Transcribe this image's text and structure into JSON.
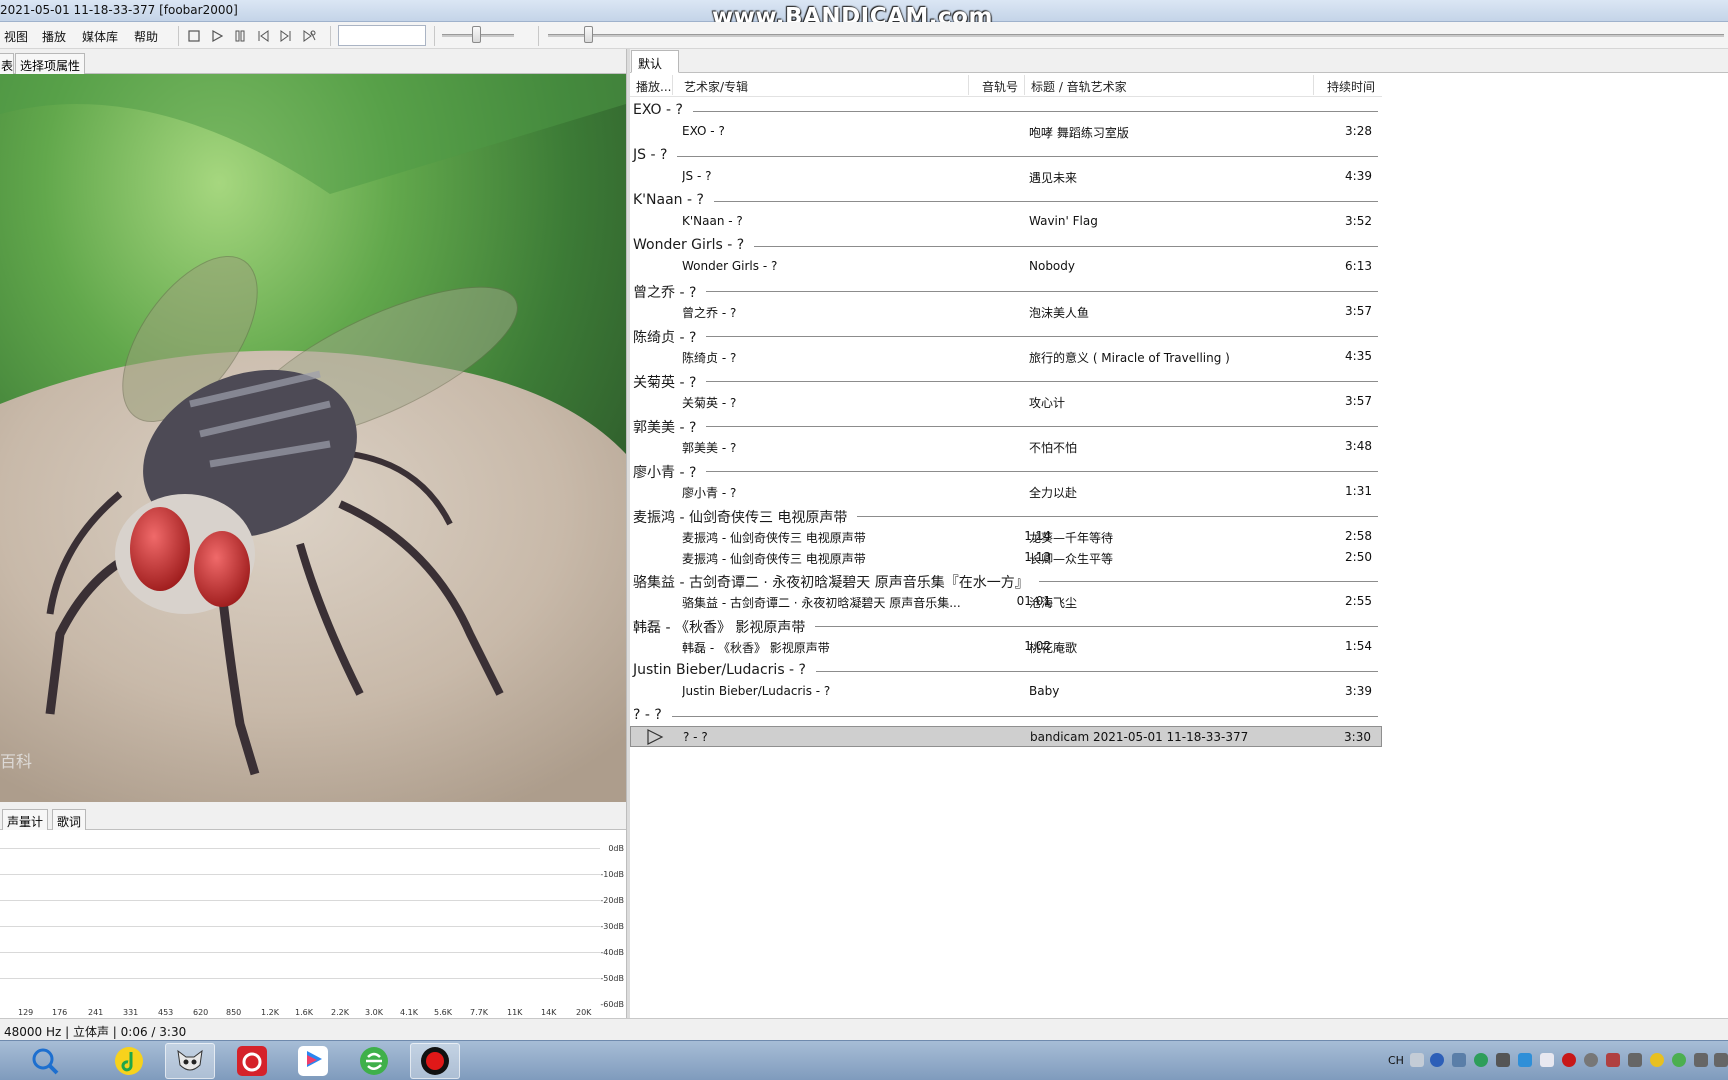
{
  "window": {
    "title": "2021-05-01 11-18-33-377  [foobar2000]",
    "watermark": "www.BANDICAM.com"
  },
  "menu": [
    "视图",
    "播放",
    "媒体库",
    "帮助"
  ],
  "toolbar": {
    "buttons": [
      "stop-icon",
      "play-icon",
      "pause-icon",
      "previous-icon",
      "next-icon",
      "random-icon"
    ]
  },
  "left_panel": {
    "tabs": [
      "表",
      "选择项属性"
    ],
    "artwork_watermark": "百科",
    "bottom_tabs": [
      "声量计",
      "歌词"
    ],
    "spectrum": {
      "db_labels": [
        "0dB",
        "-10dB",
        "-20dB",
        "-30dB",
        "-40dB",
        "-50dB",
        "-60dB"
      ],
      "freq_labels": [
        "129",
        "176",
        "241",
        "331",
        "453",
        "620",
        "850",
        "1.2K",
        "1.6K",
        "2.2K",
        "3.0K",
        "4.1K",
        "5.6K",
        "7.7K",
        "11K",
        "14K",
        "20K"
      ]
    }
  },
  "playlist": {
    "tab": "默认",
    "columns": {
      "playing": "播放...",
      "artist_album": "艺术家/专辑",
      "track_no": "音轨号",
      "title_artist": "标题 / 音轨艺术家",
      "duration": "持续时间"
    },
    "groups": [
      {
        "name": "EXO - ?",
        "tracks": [
          {
            "artist": "EXO - ?",
            "track": "",
            "title": "咆哮 舞蹈练习室版",
            "duration": "3:28"
          }
        ]
      },
      {
        "name": "JS - ?",
        "tracks": [
          {
            "artist": "JS - ?",
            "track": "",
            "title": "遇见未来",
            "duration": "4:39"
          }
        ]
      },
      {
        "name": "K'Naan - ?",
        "tracks": [
          {
            "artist": "K'Naan - ?",
            "track": "",
            "title": "Wavin' Flag",
            "duration": "3:52"
          }
        ]
      },
      {
        "name": "Wonder Girls - ?",
        "tracks": [
          {
            "artist": "Wonder Girls - ?",
            "track": "",
            "title": "Nobody",
            "duration": "6:13"
          }
        ]
      },
      {
        "name": "曾之乔 - ?",
        "tracks": [
          {
            "artist": "曾之乔 - ?",
            "track": "",
            "title": "泡沫美人鱼",
            "duration": "3:57"
          }
        ]
      },
      {
        "name": "陈绮贞 - ?",
        "tracks": [
          {
            "artist": "陈绮贞 - ?",
            "track": "",
            "title": "旅行的意义 ( Miracle of Travelling )",
            "duration": "4:35"
          }
        ]
      },
      {
        "name": "关菊英 - ?",
        "tracks": [
          {
            "artist": "关菊英 - ?",
            "track": "",
            "title": "攻心计",
            "duration": "3:57"
          }
        ]
      },
      {
        "name": "郭美美 - ?",
        "tracks": [
          {
            "artist": "郭美美 - ?",
            "track": "",
            "title": "不怕不怕",
            "duration": "3:48"
          }
        ]
      },
      {
        "name": "廖小青 - ?",
        "tracks": [
          {
            "artist": "廖小青 - ?",
            "track": "",
            "title": "全力以赴",
            "duration": "1:31"
          }
        ]
      },
      {
        "name": "麦振鸿 - 仙剑奇侠传三 电视原声带",
        "tracks": [
          {
            "artist": "麦振鸿 - 仙剑奇侠传三 电视原声带",
            "track": "1.14",
            "title": "龙葵—千年等待",
            "duration": "2:58"
          },
          {
            "artist": "麦振鸿 - 仙剑奇侠传三 电视原声带",
            "track": "1.13",
            "title": "长卿—众生平等",
            "duration": "2:50"
          }
        ]
      },
      {
        "name": "骆集益 - 古剑奇谭二 · 永夜初晗凝碧天 原声音乐集『在水一方』",
        "tracks": [
          {
            "artist": "骆集益 - 古剑奇谭二 · 永夜初晗凝碧天 原声音乐集...",
            "track": "01.01",
            "title": "沧海飞尘",
            "duration": "2:55"
          }
        ]
      },
      {
        "name": "韩磊 - 《秋香》 影视原声带",
        "tracks": [
          {
            "artist": "韩磊 - 《秋香》 影视原声带",
            "track": "1.02",
            "title": "桃花庵歌",
            "duration": "1:54"
          }
        ]
      },
      {
        "name": "Justin Bieber/Ludacris - ?",
        "tracks": [
          {
            "artist": "Justin Bieber/Ludacris - ?",
            "track": "",
            "title": "Baby",
            "duration": "3:39"
          }
        ]
      },
      {
        "name": "? - ?",
        "tracks": [
          {
            "artist": "? - ?",
            "track": "",
            "title": "bandicam 2021-05-01 11-18-33-377",
            "duration": "3:30",
            "playing": true
          }
        ]
      }
    ]
  },
  "status": {
    "text": "48000 Hz | 立体声 | 0:06 / 3:30"
  },
  "taskbar": {
    "apps": [
      "search-app-icon",
      "qq-music-icon",
      "foobar2000-icon",
      "netease-music-icon",
      "youku-icon",
      "browser-icon",
      "bandicam-icon"
    ],
    "tray_lang": "CH"
  },
  "colors": {
    "playing_row": "#cfcfcf",
    "group_line": "#8c8c8c",
    "taskbar": "#8fa8c6"
  }
}
